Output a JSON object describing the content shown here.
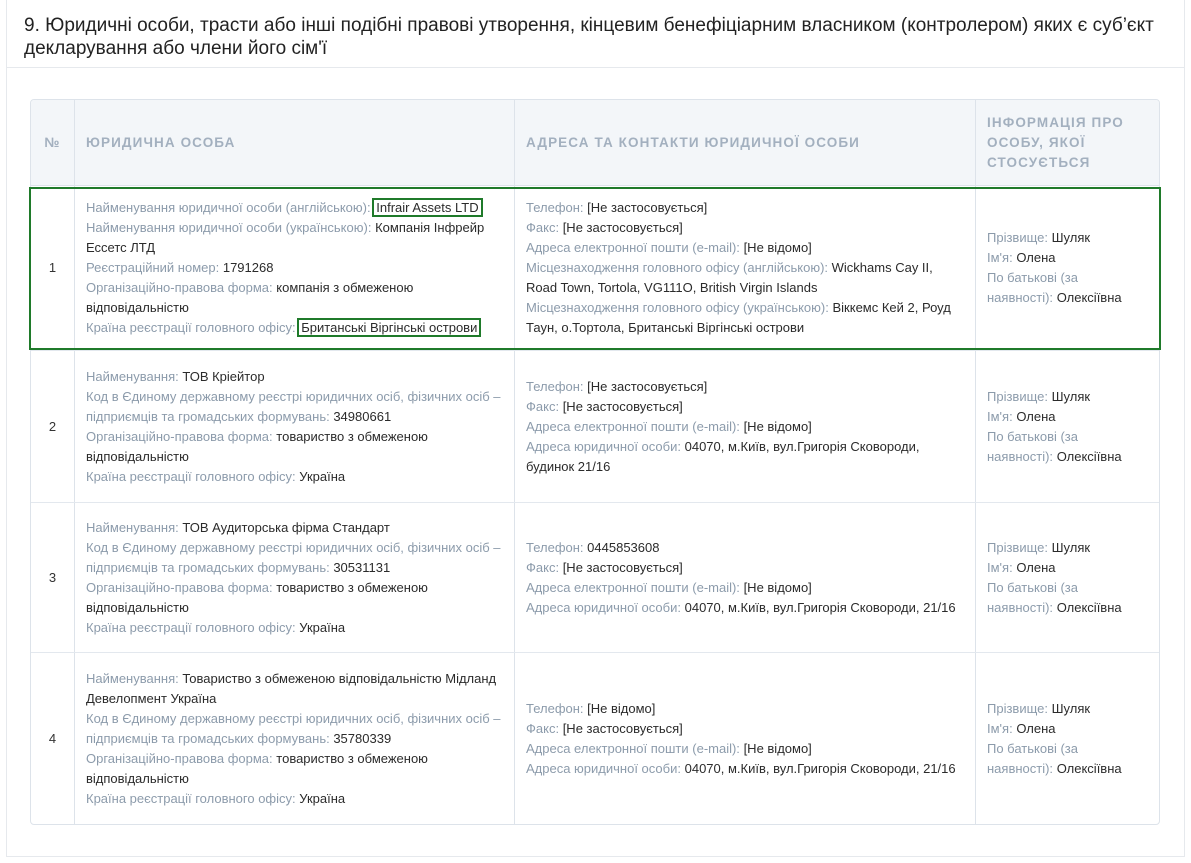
{
  "section": {
    "title": "9. Юридичні особи, трасти або інші подібні правові утворення, кінцевим бенефіціарним власником (контролером) яких є суб’єкт декларування або члени його сім'ї"
  },
  "table": {
    "headers": {
      "num": "№",
      "entity": "Юридична особа",
      "address": "Адреса та контакти юридичної особи",
      "person": "Інформація про особу, якої стосується"
    },
    "labels": {
      "name_en": "Найменування юридичної особи (англійською):",
      "name_ua": "Найменування юридичної особи (українською):",
      "reg_num": "Реєстраційний номер:",
      "legal_form": "Організаційно-правова форма:",
      "reg_country": "Країна реєстрації головного офісу:",
      "name": "Найменування:",
      "edrpou": "Код в Єдиному державному реєстрі юридичних осіб, фізичних осіб – підприємців та громадських формувань:",
      "phone": "Телефон:",
      "fax": "Факс:",
      "email": "Адреса електронної пошти (e-mail):",
      "hq_en": "Місцезнаходження головного офісу (англійською):",
      "hq_ua": "Місцезнаходження головного офісу (українською):",
      "legal_address": "Адреса юридичної особи:",
      "surname": "Прізвище:",
      "first_name": "Ім'я:",
      "patronymic": "По батькові (за наявності):"
    },
    "rows": [
      {
        "num": "1",
        "name_en": "Infrair Assets LTD",
        "name_ua": "Компанія Інфрейр Ессетс ЛТД",
        "reg_num": "1791268",
        "legal_form": "компанія з обмеженою відповідальністю",
        "reg_country": "Британські Віргінські острови",
        "phone": "[Не застосовується]",
        "fax": "[Не застосовується]",
        "email": "[Не відомо]",
        "hq_en": "Wickhams Cay II, Road Town, Tortola, VG111O, British Virgin Islands",
        "hq_ua": "Віккемс Кей 2, Роуд Таун, о.Тортола, Британські Віргінські острови",
        "surname": "Шуляк",
        "first_name": "Олена",
        "patronymic": "Олексіївна"
      },
      {
        "num": "2",
        "name": "ТОВ Кріейтор",
        "edrpou": "34980661",
        "legal_form": "товариство з обмеженою відповідальністю",
        "reg_country": "Україна",
        "phone": "[Не застосовується]",
        "fax": "[Не застосовується]",
        "email": "[Не відомо]",
        "legal_address": "04070, м.Київ, вул.Григорія Сковороди, будинок 21/16",
        "surname": "Шуляк",
        "first_name": "Олена",
        "patronymic": "Олексіївна"
      },
      {
        "num": "3",
        "name": "ТОВ Аудиторська фірма Стандарт",
        "edrpou": "30531131",
        "legal_form": "товариство з обмеженою відповідальністю",
        "reg_country": "Україна",
        "phone": "0445853608",
        "fax": "[Не застосовується]",
        "email": "[Не відомо]",
        "legal_address": "04070, м.Київ, вул.Григорія Сковороди, 21/16",
        "surname": "Шуляк",
        "first_name": "Олена",
        "patronymic": "Олексіївна"
      },
      {
        "num": "4",
        "name": "Товариство з обмеженою відповідальністю Мідланд Девелопмент Україна",
        "edrpou": "35780339",
        "legal_form": "товариство з обмеженою відповідальністю",
        "reg_country": "Україна",
        "phone": "[Не відомо]",
        "fax": "[Не застосовується]",
        "email": "[Не відомо]",
        "legal_address": "04070, м.Київ, вул.Григорія Сковороди, 21/16",
        "surname": "Шуляк",
        "first_name": "Олена",
        "patronymic": "Олексіївна"
      }
    ]
  },
  "colors": {
    "highlight": "#1f7a2a",
    "label": "#8c9bab",
    "header_text": "#a3b0bf",
    "header_bg": "#f3f6f9"
  }
}
